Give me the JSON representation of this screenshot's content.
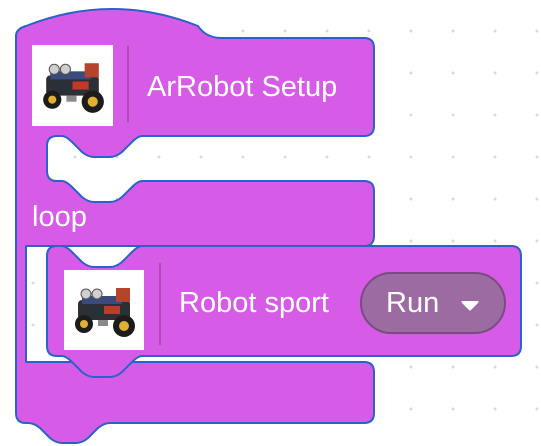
{
  "blocks": {
    "setup": {
      "icon": "robot-car-icon",
      "label": "ArRobot Setup"
    },
    "loop": {
      "label": "loop"
    },
    "robot_sport": {
      "icon": "robot-car-icon",
      "label": "Robot sport",
      "dropdown": {
        "selected": "Run",
        "arrow_icon": "caret-down-icon"
      }
    }
  },
  "colors": {
    "block_fill": "#d65ce8",
    "block_stroke": "#2a62c9",
    "dropdown_fill": "#9b6ba2",
    "text": "#ffffff"
  }
}
